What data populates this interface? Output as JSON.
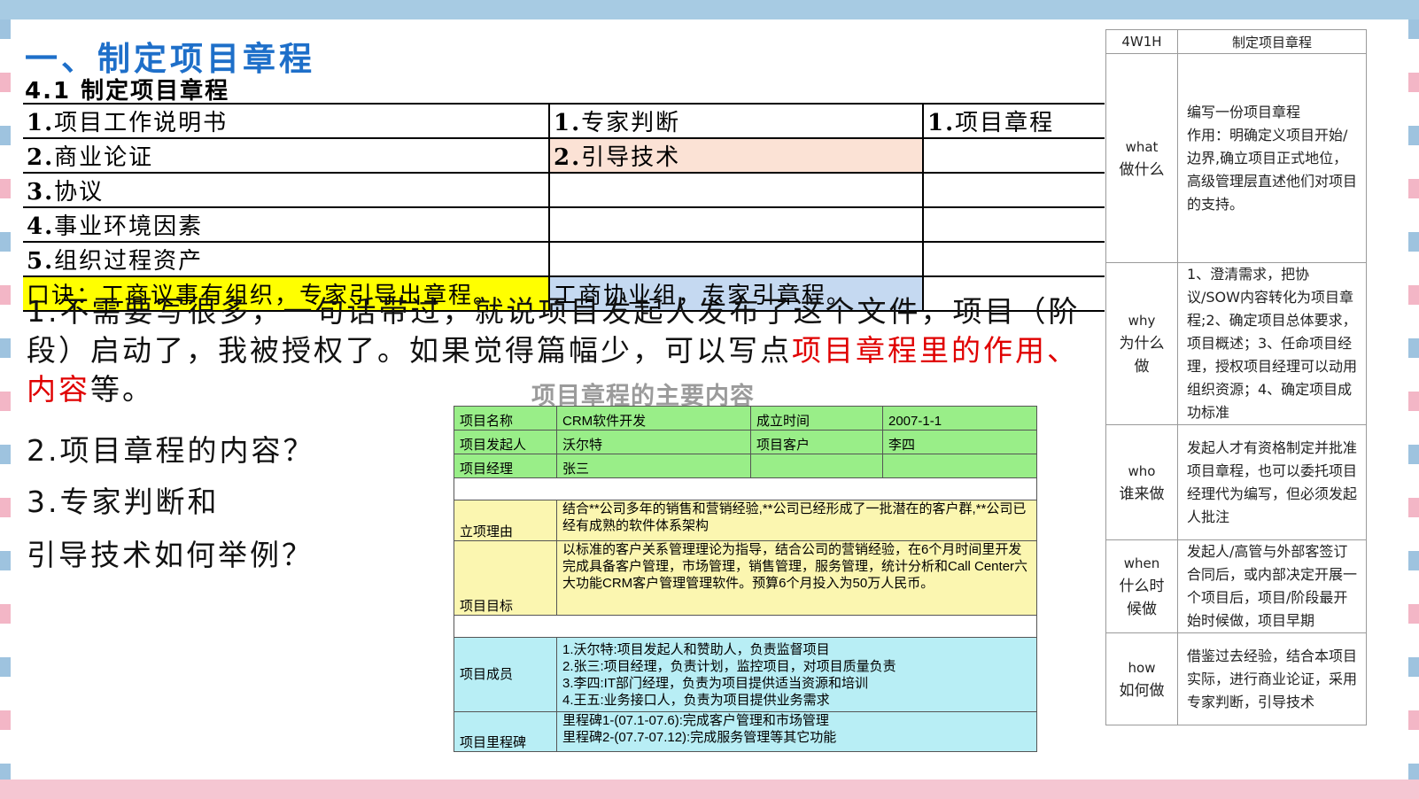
{
  "heading": "一、制定项目章程",
  "subheading": "4.1 制定项目章程",
  "itto_rows": [
    [
      {
        "n": "1.",
        "t": "项目工作说明书"
      },
      {
        "n": "1.",
        "t": "专家判断"
      },
      {
        "n": "1.",
        "t": "项目章程"
      }
    ],
    [
      {
        "n": "2.",
        "t": "商业论证"
      },
      {
        "n": "2.",
        "t": "引导技术"
      },
      {
        "n": "",
        "t": ""
      }
    ],
    [
      {
        "n": "3.",
        "t": "协议"
      },
      {
        "n": "",
        "t": ""
      },
      {
        "n": "",
        "t": ""
      }
    ],
    [
      {
        "n": "4.",
        "t": "事业环境因素"
      },
      {
        "n": "",
        "t": ""
      },
      {
        "n": "",
        "t": ""
      }
    ],
    [
      {
        "n": "5.",
        "t": "组织过程资产"
      },
      {
        "n": "",
        "t": ""
      },
      {
        "n": "",
        "t": ""
      }
    ]
  ],
  "mnemonic_1": "口诀：工商议事有组织，专家引导出章程。",
  "mnemonic_2": "工商协业组，专家引章程。",
  "note1_black": "1.不需要写很多，一句话带过，就说项目发起人发布了这个文件，项目（阶段）启动了，我被授权了。如果觉得篇幅少，可以写点",
  "note1_red": "项目章程里的作用、内容",
  "note1_end": "等。",
  "note2": "2.项目章程的内容？",
  "note3a": "3.专家判断和",
  "note3b": "引导技术如何举例？",
  "charter": {
    "title": "项目章程的主要内容",
    "name_label": "项目名称",
    "name": "CRM软件开发",
    "date_label": "成立时间",
    "date": "2007-1-1",
    "sponsor_label": "项目发起人",
    "sponsor": "沃尔特",
    "client_label": "项目客户",
    "client": "李四",
    "pm_label": "项目经理",
    "pm": "张三",
    "reason_label": "立项理由",
    "reason": "结合**公司多年的销售和营销经验,**公司已经形成了一批潜在的客户群,**公司已经有成熟的软件体系架构",
    "goal_label": "项目目标",
    "goal": "以标准的客户关系管理理论为指导，结合公司的营销经验，在6个月时间里开发完成具备客户管理，市场管理，销售管理，服务管理，统计分析和Call Center六大功能CRM客户管理管理软件。预算6个月投入为50万人民币。",
    "members_label": "项目成员",
    "members": [
      "1.沃尔特:项目发起人和赞助人，负责监督项目",
      "2.张三:项目经理，负责计划，监控项目，对项目质量负责",
      "3.李四:IT部门经理，负责为项目提供适当资源和培训",
      "4.王五:业务接口人，负责为项目提供业务需求"
    ],
    "milestone_label": "项目里程碑",
    "milestones": [
      "里程碑1-(07.1-07.6):完成客户管理和市场管理",
      "里程碑2-(07.7-07.12):完成服务管理等其它功能"
    ]
  },
  "w4": {
    "header_left": "4W1H",
    "header_right": "制定项目章程",
    "rows": [
      {
        "k1": "what",
        "k2": "做什么",
        "v": "编写一份项目章程\n作用：明确定义项目开始/边界,确立项目正式地位，高级管理层直述他们对项目的支持。"
      },
      {
        "k1": "why",
        "k2": "为什么做",
        "v": "1、澄清需求，把协议/SOW内容转化为项目章程;2、确定项目总体要求，项目概述；3、任命项目经理，授权项目经理可以动用组织资源；4、确定项目成功标准"
      },
      {
        "k1": "who",
        "k2": "谁来做",
        "v": "发起人才有资格制定并批准项目章程，也可以委托项目经理代为编写，但必须发起人批注"
      },
      {
        "k1": "when",
        "k2": "什么时候做",
        "v": "发起人/高管与外部客签订合同后，或内部决定开展一个项目后，项目/阶段最开始时候做，项目早期"
      },
      {
        "k1": "how",
        "k2": "如何做",
        "v": "借鉴过去经验，结合本项目实际，进行商业论证，采用专家判断，引导技术"
      }
    ]
  }
}
